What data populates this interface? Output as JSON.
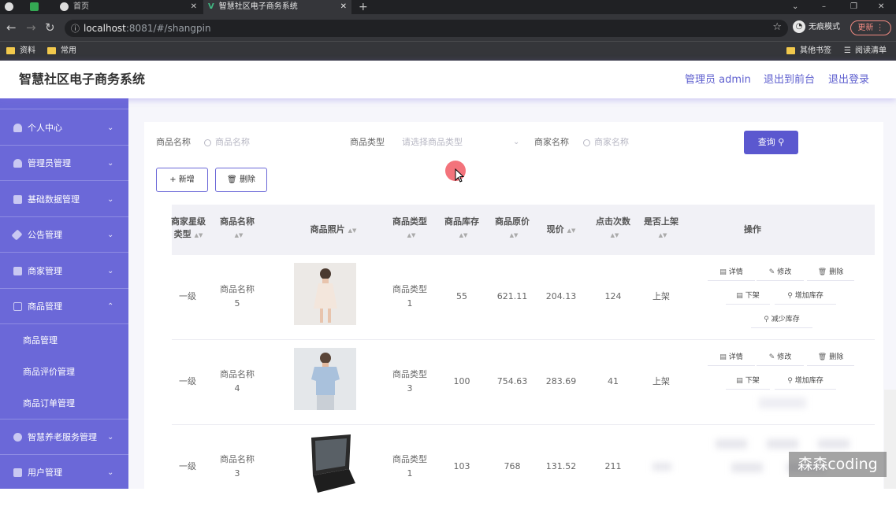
{
  "browser": {
    "tabs": [
      {
        "label": "首页",
        "active": false
      },
      {
        "label": "智慧社区电子商务系统",
        "active": true
      }
    ],
    "url_host": "localhost",
    "url_path": ":8081/#/shangpin",
    "incognito_label": "无痕模式",
    "update_label": "更新",
    "bookmarks": [
      "资料",
      "常用"
    ],
    "other_bookmarks": "其他书签",
    "reading_list": "阅读清单"
  },
  "header": {
    "title": "智慧社区电子商务系统",
    "admin_label": "管理员 admin",
    "front_link": "退出到前台",
    "logout_link": "退出登录"
  },
  "sidebar": {
    "items": [
      {
        "label": "个人中心",
        "arrow": "⌄"
      },
      {
        "label": "管理员管理",
        "arrow": "⌄"
      },
      {
        "label": "基础数据管理",
        "arrow": "⌄"
      },
      {
        "label": "公告管理",
        "arrow": "⌄"
      },
      {
        "label": "商家管理",
        "arrow": "⌄"
      },
      {
        "label": "商品管理",
        "arrow": "⌃"
      }
    ],
    "submenu": [
      "商品管理",
      "商品评价管理",
      "商品订单管理"
    ],
    "items_after": [
      {
        "label": "智慧养老服务管理",
        "arrow": "⌄"
      },
      {
        "label": "用户管理",
        "arrow": "⌄"
      }
    ]
  },
  "search": {
    "name_label": "商品名称",
    "name_placeholder": "商品名称",
    "type_label": "商品类型",
    "type_placeholder": "请选择商品类型",
    "shop_label": "商家名称",
    "shop_placeholder": "商家名称",
    "query_label": "查询"
  },
  "toolbar": {
    "add_label": "+ 新增",
    "delete_label": "删除"
  },
  "table": {
    "columns": {
      "star": [
        "商家星级",
        "类型"
      ],
      "name": "商品名称",
      "photo": "商品照片",
      "type": "商品类型",
      "stock": "商品库存",
      "original_price": "商品原价",
      "price": "现价",
      "clicks": "点击次数",
      "on_sale": "是否上架",
      "ops": "操作"
    },
    "rows": [
      {
        "star": "一级",
        "name": [
          "商品名称",
          "5"
        ],
        "type": [
          "商品类型",
          "1"
        ],
        "stock": "55",
        "original_price": "621.11",
        "price": "204.13",
        "clicks": "124",
        "on_sale": "上架"
      },
      {
        "star": "一级",
        "name": [
          "商品名称",
          "4"
        ],
        "type": [
          "商品类型",
          "3"
        ],
        "stock": "100",
        "original_price": "754.63",
        "price": "283.69",
        "clicks": "41",
        "on_sale": "上架"
      },
      {
        "star": "一级",
        "name": [
          "商品名称",
          "3"
        ],
        "type": [
          "商品类型",
          "1"
        ],
        "stock": "103",
        "original_price": "768",
        "price": "131.52",
        "clicks": "211",
        "on_sale": ""
      }
    ],
    "ops": {
      "detail": "详情",
      "edit": "修改",
      "delete": "删除",
      "off_shelf": "下架",
      "add_stock": "增加库存",
      "reduce_stock": "减少库存"
    }
  },
  "watermark": "森森coding"
}
